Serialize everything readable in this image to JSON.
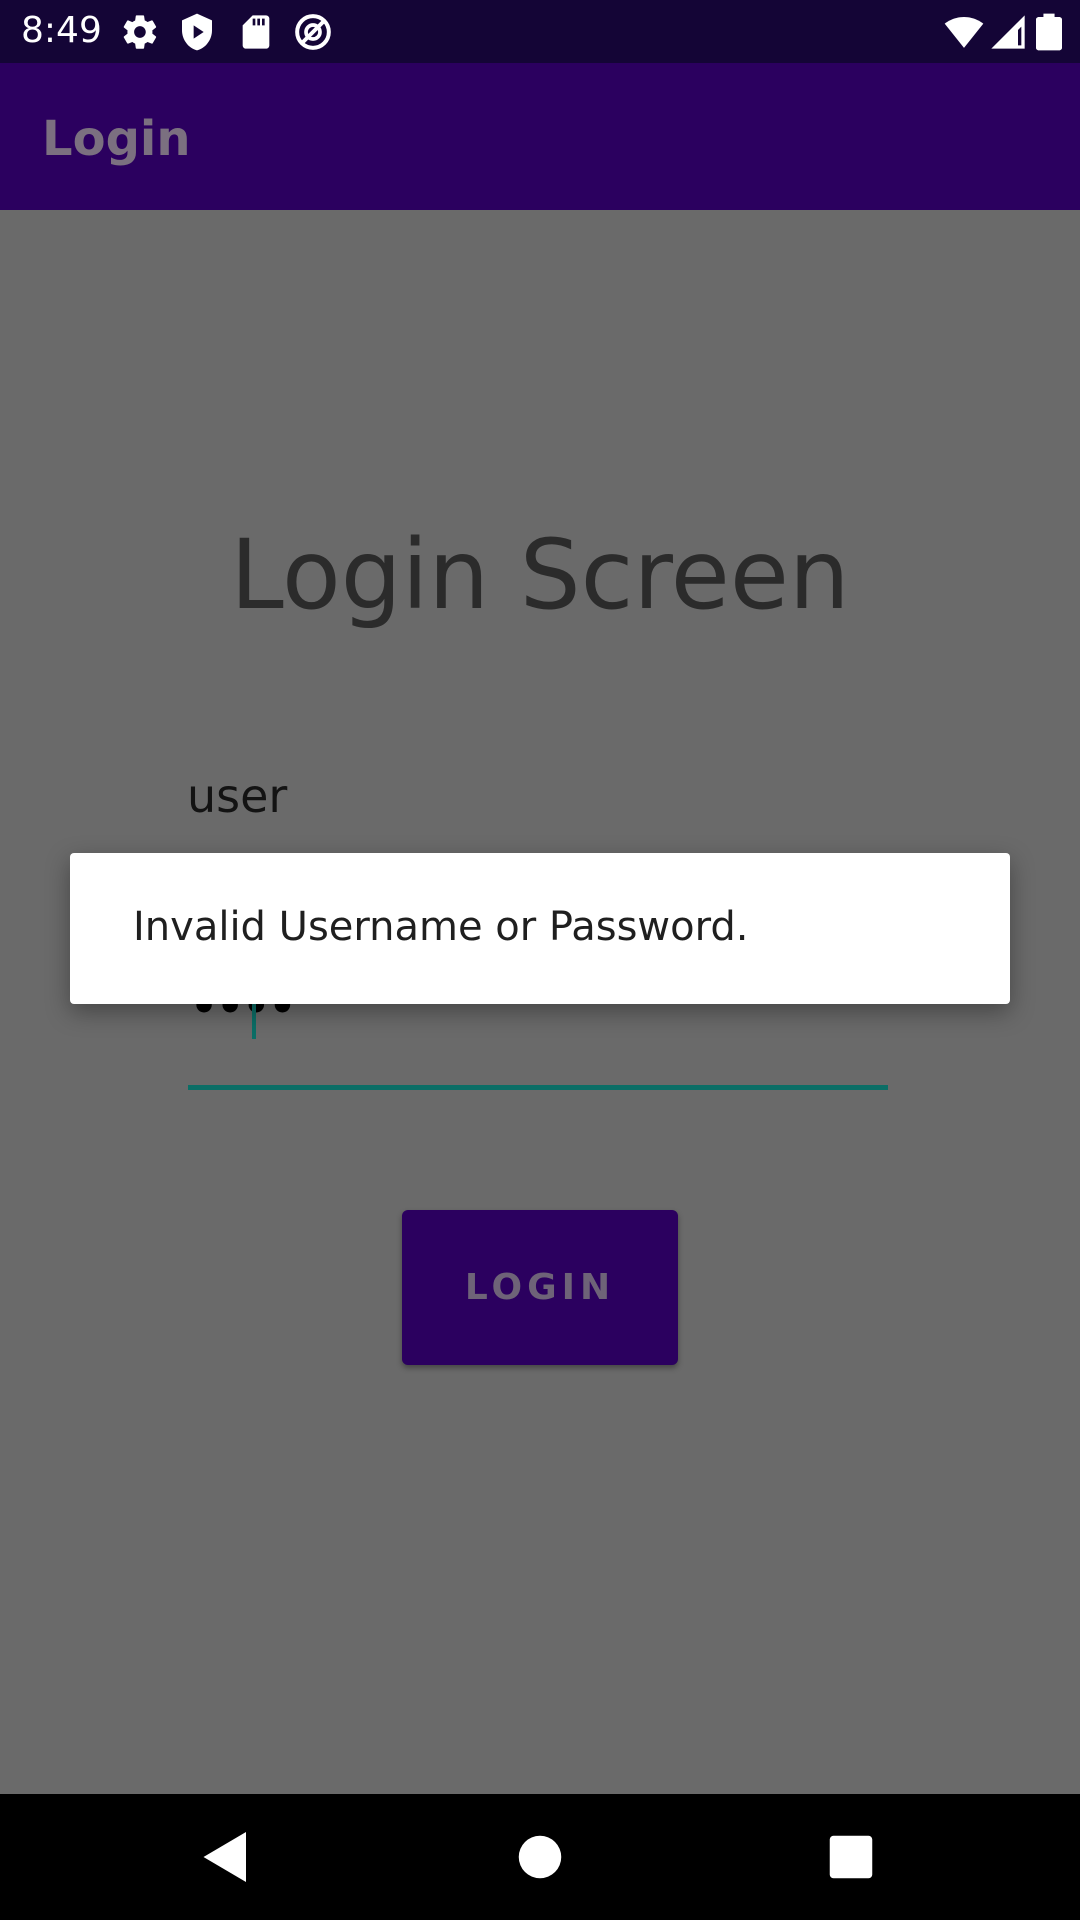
{
  "status_bar": {
    "time": "8:49",
    "icons_left": [
      "settings-icon",
      "play-protect-icon",
      "sd-card-icon",
      "do-not-disturb-icon"
    ],
    "icons_right": [
      "wifi-icon",
      "signal-icon",
      "battery-icon"
    ]
  },
  "app_bar": {
    "title": "Login"
  },
  "main": {
    "heading": "Login Screen",
    "username_value": "user",
    "password_masked": "••••"
  },
  "login_button": {
    "label": "LOGIN"
  },
  "dialog": {
    "message": "Invalid Username or Password."
  },
  "nav_bar": {
    "buttons": [
      "back-icon",
      "home-icon",
      "recents-icon"
    ]
  },
  "colors": {
    "status_bar": "#140536",
    "app_bar": "#2b005f",
    "accent": "#0b6e66",
    "scrim_background": "#6a6a6a",
    "button": "#2b005f"
  }
}
